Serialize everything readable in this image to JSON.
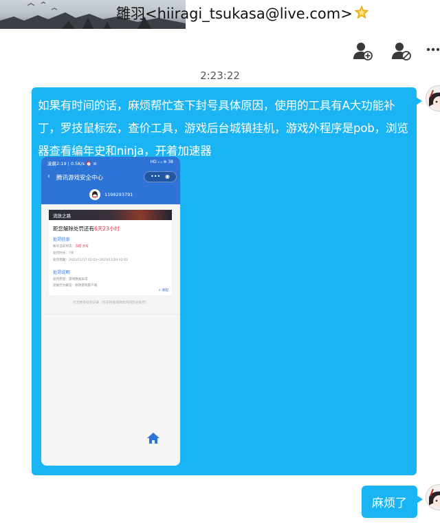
{
  "header": {
    "title": "雛羽<hiiragi_tsukasa@live.com>",
    "star_icon": "star-icon"
  },
  "actions": {
    "add_friend_icon": "add-user-icon",
    "block_icon": "block-user-icon",
    "more_icon": "more-icon"
  },
  "chat": {
    "timestamp": "2:23:22",
    "messages": [
      {
        "text": "如果有时间的话，麻烦帮忙查下封号具体原因，使用的工具有A大功能补丁，罗技鼠标宏，查价工具，游戏后台城镇挂机，游戏外程序是pob，浏览器查看编年史和ninja，开着加速器",
        "bubble_color": "#1ab4f4",
        "attachment": {
          "status_left": "凌晨2:19 | 0.5K/s ⏰ ⊘",
          "status_right": "HD ᵢₗ ᵢₗ ⊚ 38",
          "app_title": "腾讯游戏安全中心",
          "qq_number": "1198293791",
          "game_banner": "流放之路",
          "headline_prefix": "距您解除处罚还有",
          "headline_time": "6天23小时",
          "penalty_info_title": "处罚信息",
          "status_label": "账号当前状态：",
          "status_value": "冻结 封号",
          "duration_line": "处罚时长：7天",
          "period_line": "处罚周期：2023/11/17 02:02~2023/11/24 02:02",
          "penalty_desc_title": "处罚说明",
          "reason_line": "处罚原因：游戏数据异常",
          "behavior_line": "违规行为解答：修改游戏客户端",
          "collapse_label": "∧ 收起",
          "footer": "已无更多处罚记录（仅支持查询两年内的历史处罚）"
        }
      },
      {
        "text": "麻烦了",
        "bubble_color": "#1ab4f4"
      }
    ]
  }
}
